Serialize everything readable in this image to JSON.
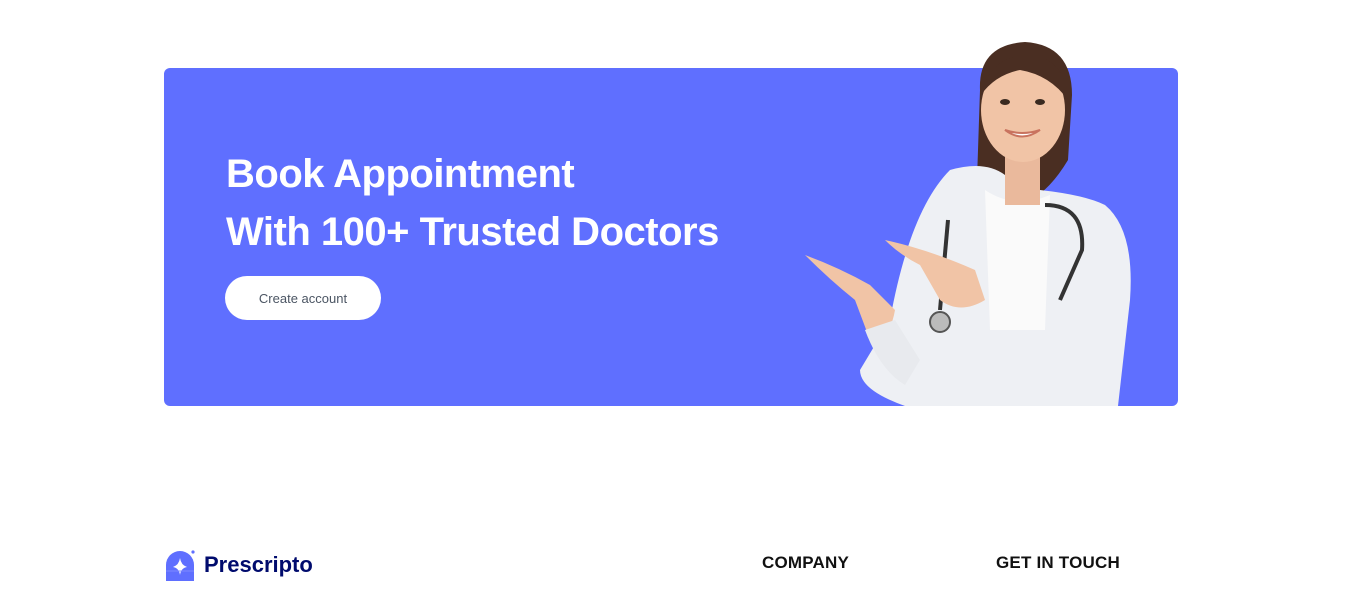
{
  "banner": {
    "title_line1": "Book Appointment",
    "title_line2": "With 100+ Trusted Doctors",
    "cta_label": "Create account",
    "background_color": "#5F6FFF",
    "image": "doctor-pointing-image"
  },
  "footer": {
    "brand": "Prescripto",
    "brand_color": "#000B6D",
    "company_heading": "COMPANY",
    "contact_heading": "GET IN TOUCH"
  }
}
